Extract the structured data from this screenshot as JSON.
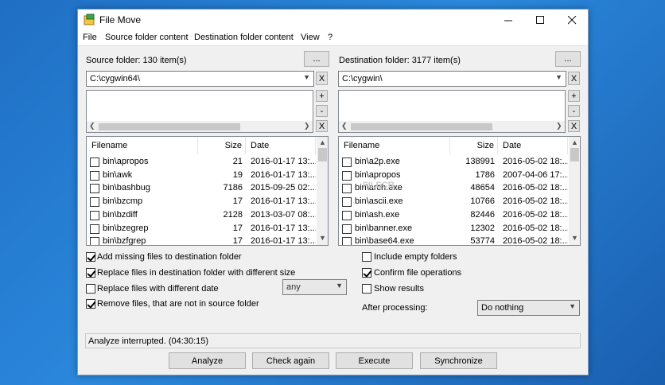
{
  "window": {
    "title": "File Move"
  },
  "menu": [
    "File",
    "Source folder content",
    "Destination folder content",
    "View",
    "?"
  ],
  "source": {
    "label": "Source folder: 130 item(s)",
    "browse_label": "...",
    "path": "C:\\cygwin64\\",
    "clear_label": "X",
    "add_label": "+",
    "remove_label": "-",
    "clear_list_label": "X",
    "columns": [
      "Filename",
      "Size",
      "Date"
    ],
    "files": [
      {
        "name": "bin\\apropos",
        "size": "21",
        "date": "2016-01-17 13:..."
      },
      {
        "name": "bin\\awk",
        "size": "19",
        "date": "2016-01-17 13:..."
      },
      {
        "name": "bin\\bashbug",
        "size": "7186",
        "date": "2015-09-25 02:..."
      },
      {
        "name": "bin\\bzcmp",
        "size": "17",
        "date": "2016-01-17 13:..."
      },
      {
        "name": "bin\\bzdiff",
        "size": "2128",
        "date": "2013-03-07 08:..."
      },
      {
        "name": "bin\\bzegrep",
        "size": "17",
        "date": "2016-01-17 13:..."
      },
      {
        "name": "bin\\bzfgrep",
        "size": "17",
        "date": "2016-01-17 13:..."
      }
    ]
  },
  "destination": {
    "label": "Destination folder: 3177 item(s)",
    "browse_label": "...",
    "path": "C:\\cygwin\\",
    "clear_label": "X",
    "add_label": "+",
    "remove_label": "-",
    "clear_list_label": "X",
    "columns": [
      "Filename",
      "Size",
      "Date"
    ],
    "files": [
      {
        "name": "bin\\a2p.exe",
        "size": "138991",
        "date": "2016-05-02 18:..."
      },
      {
        "name": "bin\\apropos",
        "size": "1786",
        "date": "2007-04-06 17:..."
      },
      {
        "name": "bin\\arch.exe",
        "size": "48654",
        "date": "2016-05-02 18:..."
      },
      {
        "name": "bin\\ascii.exe",
        "size": "10766",
        "date": "2016-05-02 18:..."
      },
      {
        "name": "bin\\ash.exe",
        "size": "82446",
        "date": "2016-05-02 18:..."
      },
      {
        "name": "bin\\banner.exe",
        "size": "12302",
        "date": "2016-05-02 18:..."
      },
      {
        "name": "bin\\base64.exe",
        "size": "53774",
        "date": "2016-05-02 18:..."
      }
    ]
  },
  "options": {
    "add_missing": {
      "label": "Add missing files to destination folder",
      "checked": true
    },
    "replace_size": {
      "label": "Replace files in destination folder with different size",
      "checked": true
    },
    "replace_date": {
      "label": "Replace files with different date",
      "checked": false
    },
    "date_mode": "any",
    "remove_files": {
      "label": "Remove files, that are not in source folder",
      "checked": true
    },
    "include_empty": {
      "label": "Include empty folders",
      "checked": false
    },
    "confirm_ops": {
      "label": "Confirm file operations",
      "checked": true
    },
    "show_results": {
      "label": "Show results",
      "checked": false
    },
    "after_label": "After processing:",
    "after_value": "Do nothing"
  },
  "status": "Analyze interrupted. (04:30:15)",
  "buttons": {
    "analyze": "Analyze",
    "check_again": "Check again",
    "execute": "Execute",
    "synchronize": "Synchronize"
  },
  "watermark": "FILECR"
}
